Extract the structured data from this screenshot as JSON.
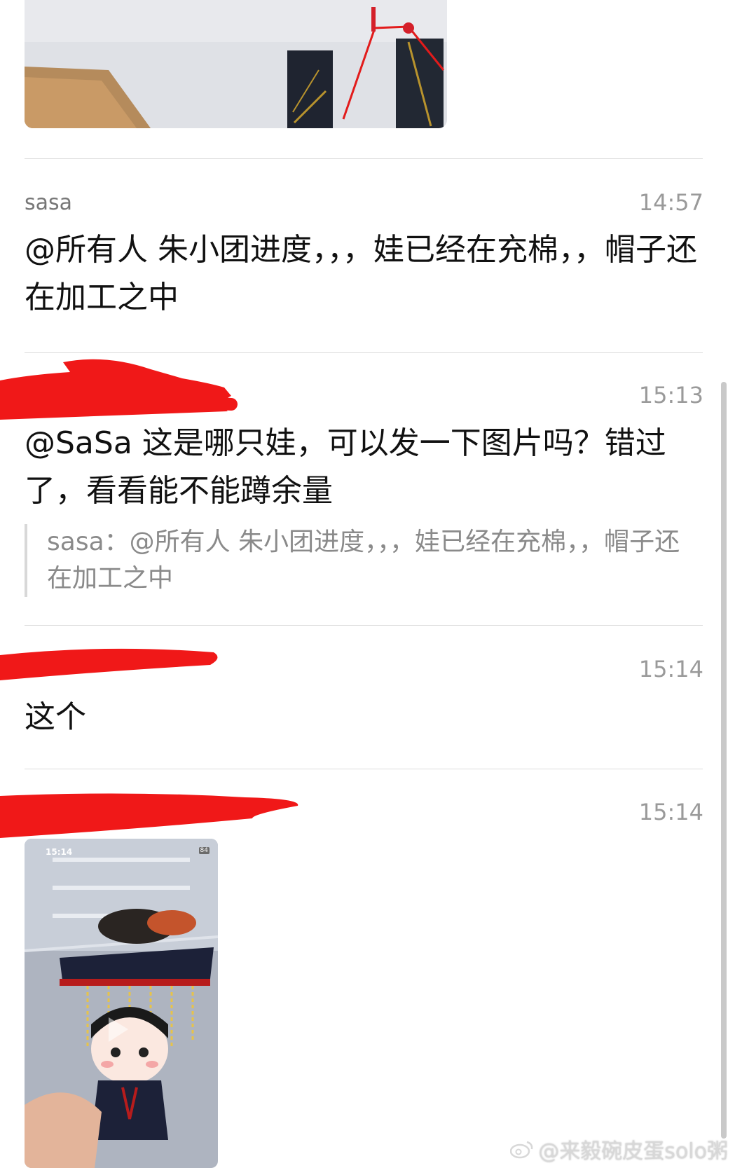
{
  "messages": [
    {
      "sender": "sasa",
      "time": "14:57",
      "text": "@所有人 朱小团进度，，，娃已经在充棉，，帽子还在加工之中"
    },
    {
      "time": "15:13",
      "text": "@SaSa 这是哪只娃，可以发一下图片吗？错过了，看看能不能蹲余量",
      "quote": "sasa：@所有人 朱小团进度，，，娃已经在充棉，，帽子还在加工之中"
    },
    {
      "time": "15:14",
      "text": "这个"
    },
    {
      "time": "15:14"
    }
  ],
  "video": {
    "status_time": "15:14",
    "battery": "84"
  },
  "watermark": "@来毅碗皮蛋solo粥",
  "colors": {
    "redaction": "#f01818",
    "divider": "#dcdcdc"
  }
}
